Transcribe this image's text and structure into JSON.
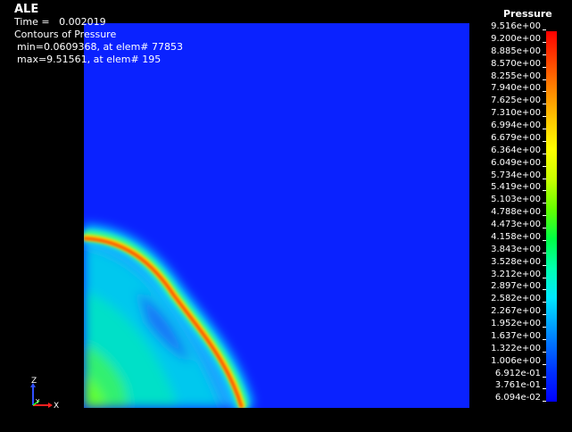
{
  "info": {
    "title": "ALE",
    "time_label": "Time =",
    "time_value": "0.002019",
    "contour_label": "Contours of Pressure",
    "min_text": "min=0.0609368, at elem# 77853",
    "max_text": "max=9.51561, at elem# 195"
  },
  "legend": {
    "title": "Pressure",
    "values": [
      "9.516e+00",
      "9.200e+00",
      "8.885e+00",
      "8.570e+00",
      "8.255e+00",
      "7.940e+00",
      "7.625e+00",
      "7.310e+00",
      "6.994e+00",
      "6.679e+00",
      "6.364e+00",
      "6.049e+00",
      "5.734e+00",
      "5.419e+00",
      "5.103e+00",
      "4.788e+00",
      "4.473e+00",
      "4.158e+00",
      "3.843e+00",
      "3.528e+00",
      "3.212e+00",
      "2.897e+00",
      "2.582e+00",
      "2.267e+00",
      "1.952e+00",
      "1.637e+00",
      "1.322e+00",
      "1.006e+00",
      "6.912e-01",
      "3.761e-01",
      "6.094e-02"
    ]
  },
  "triad": {
    "z": "Z",
    "y": "Y",
    "x": "X"
  },
  "colors": {
    "background": "#000000",
    "field_low": "#0a22ff",
    "front_peak": "#ff3000"
  }
}
